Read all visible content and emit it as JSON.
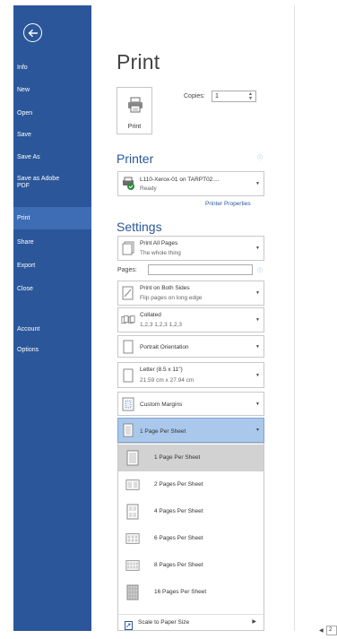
{
  "sidebar": {
    "items": [
      {
        "label": "Info"
      },
      {
        "label": "New"
      },
      {
        "label": "Open"
      },
      {
        "label": "Save"
      },
      {
        "label": "Save As"
      },
      {
        "label": "Save as Adobe",
        "label2": "PDF"
      },
      {
        "label": "Print"
      },
      {
        "label": "Share"
      },
      {
        "label": "Export"
      },
      {
        "label": "Close"
      },
      {
        "label": "Account"
      },
      {
        "label": "Options"
      }
    ],
    "colors": {
      "background": "#2b579a",
      "selected": "#3e6db5"
    }
  },
  "main": {
    "title": "Print",
    "print_button": {
      "label": "Print",
      "icon": "printer-icon"
    },
    "copies": {
      "label": "Copies:",
      "value": "1"
    },
    "printer": {
      "heading": "Printer",
      "name": "L110-Xerox-01 on TARPT02....",
      "status": "Ready",
      "properties_link": "Printer Properties"
    },
    "settings": {
      "heading": "Settings",
      "print_range": {
        "title": "Print All Pages",
        "subtitle": "The whole thing"
      },
      "pages": {
        "label": "Pages:",
        "value": ""
      },
      "sides": {
        "title": "Print on Both Sides",
        "subtitle": "Flip pages on long edge"
      },
      "collation": {
        "title": "Collated",
        "subtitle": "1,2,3   1,2,3   1,2,3"
      },
      "orientation": {
        "title": "Portrait Orientation"
      },
      "paper": {
        "title": "Letter (8.5 x 11\")",
        "subtitle": "21.59 cm x 27.94 cm"
      },
      "margins": {
        "title": "Custom Margins"
      },
      "per_sheet": {
        "title": "1 Page Per Sheet"
      },
      "per_sheet_options": [
        {
          "label": "1 Page Per Sheet",
          "selected": true
        },
        {
          "label": "2 Pages Per Sheet"
        },
        {
          "label": "4 Pages Per Sheet"
        },
        {
          "label": "6 Pages Per Sheet"
        },
        {
          "label": "8 Pages Per Sheet"
        },
        {
          "label": "16 Pages Per Sheet"
        }
      ],
      "scale": {
        "label": "Scale to Paper Size"
      }
    }
  },
  "preview": {
    "page_number": "2"
  },
  "colors": {
    "accent": "#2b579a",
    "dropdown_open": "#aac8eb",
    "menu_highlight": "#d2d2d2"
  }
}
